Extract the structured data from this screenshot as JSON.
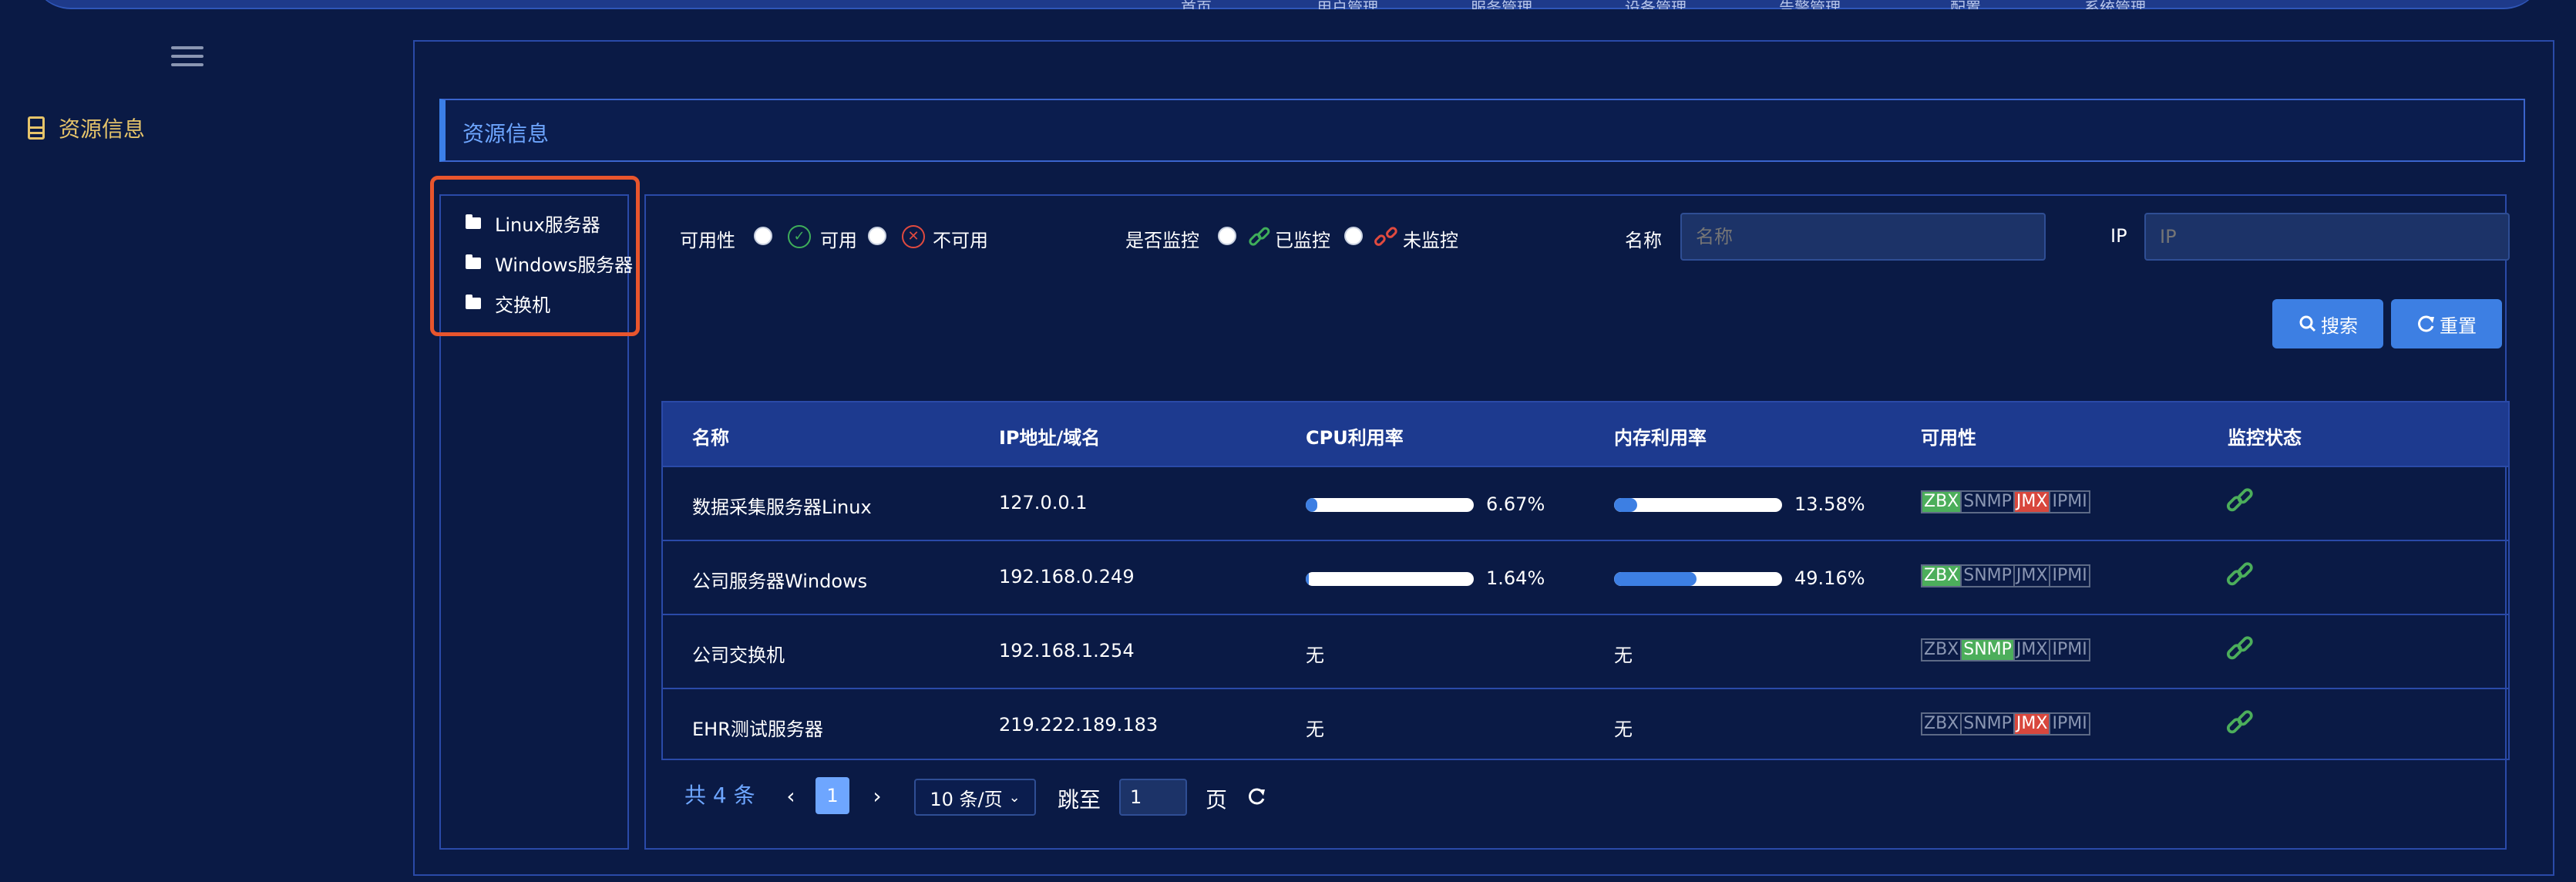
{
  "topnav": {
    "items": [
      "首页",
      "用户管理",
      "服务管理",
      "设备管理",
      "告警管理",
      "配置",
      "系统管理"
    ]
  },
  "sidebar": {
    "menu": [
      {
        "label": "资源信息",
        "icon": "server-icon"
      }
    ]
  },
  "main": {
    "title": "资源信息"
  },
  "tree": {
    "items": [
      {
        "label": "Linux服务器",
        "icon": "folder-icon"
      },
      {
        "label": "Windows服务器",
        "icon": "folder-icon"
      },
      {
        "label": "交换机",
        "icon": "folder-icon"
      }
    ]
  },
  "filters": {
    "availability_label": "可用性",
    "available_label": "可用",
    "unavailable_label": "不可用",
    "monitor_label": "是否监控",
    "monitored_label": "已监控",
    "unmonitored_label": "未监控",
    "name_label": "名称",
    "name_placeholder": "名称",
    "ip_label": "IP",
    "ip_placeholder": "IP",
    "search_button": "搜索",
    "reset_button": "重置"
  },
  "table": {
    "headers": [
      "名称",
      "IP地址/域名",
      "CPU利用率",
      "内存利用率",
      "可用性",
      "监控状态"
    ],
    "rows": [
      {
        "name": "数据采集服务器Linux",
        "ip": "127.0.0.1",
        "cpu": "6.67%",
        "cpu_value": 6.67,
        "mem": "13.58%",
        "mem_value": 13.58,
        "tags": [
          {
            "label": "ZBX",
            "state": "ok"
          },
          {
            "label": "SNMP",
            "state": "none"
          },
          {
            "label": "JMX",
            "state": "error"
          },
          {
            "label": "IPMI",
            "state": "none"
          }
        ]
      },
      {
        "name": "公司服务器Windows",
        "ip": "192.168.0.249",
        "cpu": "1.64%",
        "cpu_value": 1.64,
        "mem": "49.16%",
        "mem_value": 49.16,
        "tags": [
          {
            "label": "ZBX",
            "state": "ok"
          },
          {
            "label": "SNMP",
            "state": "none"
          },
          {
            "label": "JMX",
            "state": "none"
          },
          {
            "label": "IPMI",
            "state": "none"
          }
        ]
      },
      {
        "name": "公司交换机",
        "ip": "192.168.1.254",
        "cpu": "无",
        "cpu_value": null,
        "mem": "无",
        "mem_value": null,
        "tags": [
          {
            "label": "ZBX",
            "state": "none"
          },
          {
            "label": "SNMP",
            "state": "ok"
          },
          {
            "label": "JMX",
            "state": "none"
          },
          {
            "label": "IPMI",
            "state": "none"
          }
        ]
      },
      {
        "name": "EHR测试服务器",
        "ip": "219.222.189.183",
        "cpu": "无",
        "cpu_value": null,
        "mem": "无",
        "mem_value": null,
        "tags": [
          {
            "label": "ZBX",
            "state": "none"
          },
          {
            "label": "SNMP",
            "state": "none"
          },
          {
            "label": "JMX",
            "state": "error"
          },
          {
            "label": "IPMI",
            "state": "none"
          }
        ]
      }
    ]
  },
  "pagination": {
    "total": "共 4 条",
    "current_page": "1",
    "page_size": "10 条/页",
    "jump_label": "跳至",
    "jump_value": "1",
    "page_suffix": "页"
  },
  "colors": {
    "accent": "#3d7fe3",
    "ok": "#4cae5b",
    "error": "#d8473d",
    "highlight_box": "#e8552d",
    "background": "#0a1a45"
  }
}
